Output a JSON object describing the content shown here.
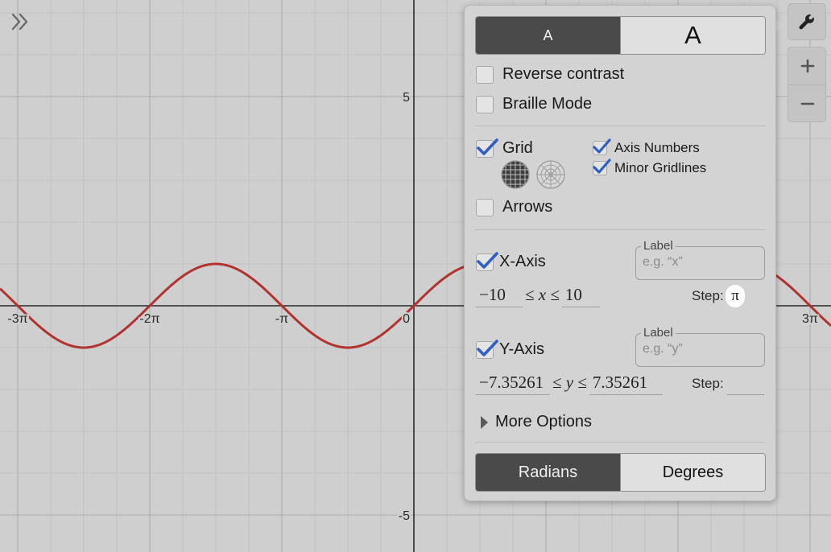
{
  "graph": {
    "x_ticks": [
      "-3π",
      "-2π",
      "-π",
      "0",
      "3π"
    ],
    "y_ticks": [
      "5",
      "-5"
    ],
    "curve_color": "#b0332f",
    "x_range": [
      -10,
      10
    ],
    "y_range": [
      -7.35261,
      7.35261
    ],
    "x_step": "π",
    "grid_on": true
  },
  "settings": {
    "text_size": {
      "small": "A",
      "large": "A",
      "selected": "small"
    },
    "reverse_contrast": {
      "label": "Reverse contrast",
      "checked": false
    },
    "braille_mode": {
      "label": "Braille Mode",
      "checked": false
    },
    "grid": {
      "label": "Grid",
      "checked": true
    },
    "axis_numbers": {
      "label": "Axis Numbers",
      "checked": true
    },
    "minor_gridlines": {
      "label": "Minor Gridlines",
      "checked": true
    },
    "arrows": {
      "label": "Arrows",
      "checked": false
    },
    "x_axis": {
      "label": "X-Axis",
      "checked": true,
      "label_legend": "Label",
      "label_placeholder": "e.g. “x”",
      "min": "−10",
      "max": "10",
      "var": "x",
      "step_label": "Step:",
      "step": "π"
    },
    "y_axis": {
      "label": "Y-Axis",
      "checked": true,
      "label_legend": "Label",
      "label_placeholder": "e.g. “y”",
      "min": "−7.35261",
      "max": "7.35261",
      "var": "y",
      "step_label": "Step:",
      "step": ""
    },
    "more_options": "More Options",
    "angle_mode": {
      "radians": "Radians",
      "degrees": "Degrees",
      "selected": "radians"
    }
  },
  "colors": {
    "accent_check": "#2f5fc4",
    "active_segment": "#4a4a4a"
  },
  "icons": {
    "expand": "double-chevron-right-icon",
    "wrench": "wrench-icon",
    "zoom_in": "plus-icon",
    "zoom_out": "minus-icon"
  }
}
